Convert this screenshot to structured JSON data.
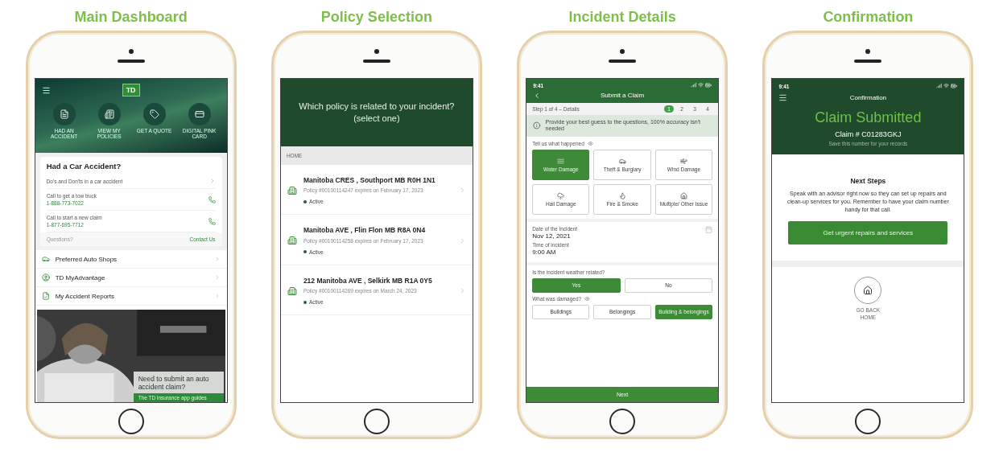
{
  "panels": [
    {
      "kind": "dashboard",
      "heading": "Main Dashboard",
      "logo": "TD",
      "shortcuts": [
        {
          "kind": "accident",
          "label": "HAD AN ACCIDENT"
        },
        {
          "kind": "policies",
          "label": "VIEW MY POLICIES"
        },
        {
          "kind": "quote",
          "label": "GET A QUOTE"
        },
        {
          "kind": "card",
          "label": "DIGITAL PINK CARD"
        }
      ],
      "accident_card": {
        "title": "Had a Car Accident?",
        "rows": [
          {
            "kind": "link",
            "label": "Do's and Don'ts in a car accident"
          },
          {
            "kind": "call",
            "label": "Call to get a tow truck",
            "number": "1-888-773-7022"
          },
          {
            "kind": "call",
            "label": "Call to start a new claim",
            "number": "1-877-695-7712"
          }
        ],
        "footer_label": "Questions?",
        "footer_link": "Contact Us"
      },
      "menu": [
        {
          "kind": "shops",
          "label": "Preferred Auto Shops"
        },
        {
          "kind": "advantage",
          "label": "TD MyAdvantage"
        },
        {
          "kind": "reports",
          "label": "My Accident Reports"
        }
      ],
      "banner": {
        "title": "Need to submit an auto accident claim?",
        "subtitle": "The TD insurance app guides"
      }
    },
    {
      "kind": "policies",
      "heading": "Policy Selection",
      "question": "Which policy is related to your incident? (select one)",
      "section": "HOME",
      "policies": [
        {
          "address": "Manitoba CRES , Southport MB R0H 1N1",
          "detail": "Policy #00100114247 expires on February 17, 2023",
          "status": "Active"
        },
        {
          "address": "Manitoba AVE , Flin Flon MB R8A 0N4",
          "detail": "Policy #00100114258 expires on February 17, 2023",
          "status": "Active"
        },
        {
          "address": "212 Manitoba AVE , Selkirk MB R1A 0Y5",
          "detail": "Policy #00100114269 expires on March 24, 2023",
          "status": "Active"
        }
      ]
    },
    {
      "kind": "incident",
      "heading": "Incident Details",
      "time": "9:41",
      "title": "Submit a Claim",
      "step": "Step 1 of 4 – Details",
      "steps": [
        {
          "label": "1",
          "selected": true
        },
        {
          "label": "2",
          "selected": false
        },
        {
          "label": "3",
          "selected": false
        },
        {
          "label": "4",
          "selected": false
        }
      ],
      "info": "Provide your best guess to the questions, 100% accuracy isn't needed",
      "happened_label": "Tell us what happened",
      "tiles": [
        {
          "kind": "water",
          "label": "Water Damage",
          "selected": true
        },
        {
          "kind": "theft",
          "label": "Theft & Burglary",
          "selected": false
        },
        {
          "kind": "wind",
          "label": "Wind Damage",
          "selected": false
        },
        {
          "kind": "hail",
          "label": "Hail Damage",
          "selected": false
        },
        {
          "kind": "fire",
          "label": "Fire & Smoke",
          "selected": false
        },
        {
          "kind": "other",
          "label": "Multiple/ Other Issue",
          "selected": false
        }
      ],
      "date_label": "Date of the incident",
      "date": "Nov 12, 2021",
      "time_label": "Time of incident",
      "time_value": "9:00 AM",
      "weather_question": "Is the incident weather related?",
      "weather": [
        {
          "label": "Yes",
          "selected": true
        },
        {
          "label": "No",
          "selected": false
        }
      ],
      "damaged_question": "What was damaged?",
      "damaged": [
        {
          "label": "Buildings",
          "selected": false
        },
        {
          "label": "Belongings",
          "selected": false
        },
        {
          "label": "Building & belongings",
          "selected": true
        }
      ],
      "next": "Next"
    },
    {
      "kind": "confirmation",
      "heading": "Confirmation",
      "time": "9:41",
      "title": "Confirmation",
      "headline": "Claim Submitted",
      "claim": "Claim # C01283GKJ",
      "note": "Save this number for your records",
      "next_title": "Next Steps",
      "next_text": "Speak with an advisor right now so they can set up repairs and clean-up services for you. Remember to have your claim number handy for that call.",
      "action": "Get urgent repairs and services",
      "home": "GO BACK HOME"
    }
  ]
}
